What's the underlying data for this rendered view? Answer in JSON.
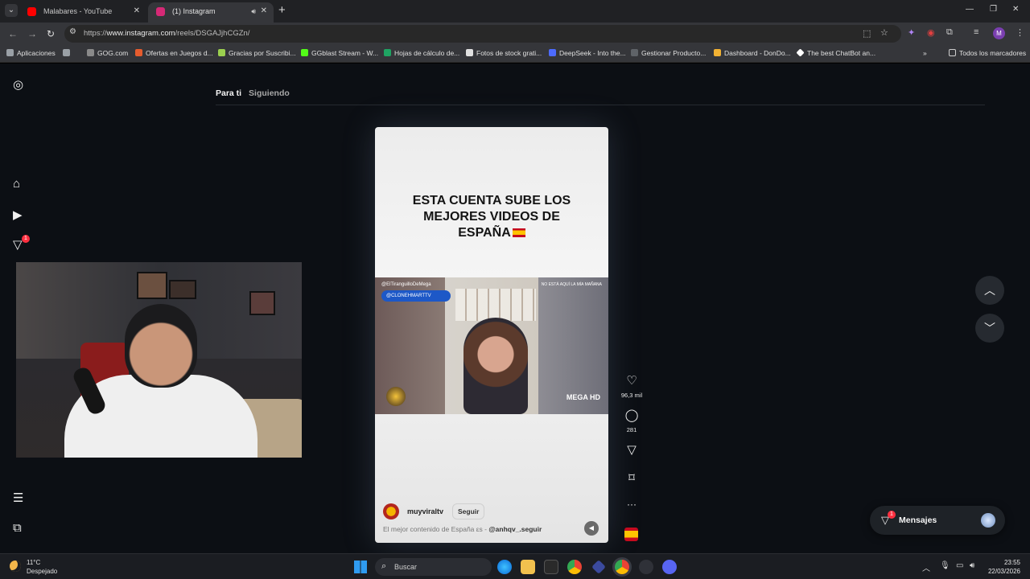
{
  "browser": {
    "tabs": [
      {
        "label": "Malabares - YouTube",
        "active": false,
        "favicon_color": "#ff0000"
      },
      {
        "label": "(1) Instagram",
        "active": true,
        "favicon_color": "#d62976"
      }
    ],
    "url_prefix": "https://",
    "url_host": "www.instagram.com",
    "url_path": "/reels/DSGAJjhCGZn/",
    "bookmarks": [
      {
        "label": "Aplicaciones",
        "icon": "apps-grid-icon"
      },
      {
        "label": "GOG.com",
        "icon": "gog-icon"
      },
      {
        "label": "Ofertas en Juegos d...",
        "icon": "tag-icon"
      },
      {
        "label": "Gracias por Suscribi...",
        "icon": "mail-icon"
      },
      {
        "label": "GGblast Stream - W...",
        "icon": "k-icon"
      },
      {
        "label": "Hojas de cálculo de...",
        "icon": "sheets-icon"
      },
      {
        "label": "Fotos de stock grati...",
        "icon": "photo-icon"
      },
      {
        "label": "DeepSeek - Into the...",
        "icon": "deepseek-icon"
      },
      {
        "label": "Gestionar Producto...",
        "icon": "box-icon"
      },
      {
        "label": "Dashboard - DonDo...",
        "icon": "folder-icon"
      },
      {
        "label": "The best ChatBot an...",
        "icon": "diamond-icon"
      }
    ],
    "bookmarks_overflow": "»",
    "all_bookmarks": "Todos los marcadores",
    "profile_initial": "M"
  },
  "instagram": {
    "feed_tabs": [
      "Para ti",
      "Siguiendo"
    ],
    "sidebar_badge": "1",
    "reel": {
      "headline_lines": [
        "ESTA CUENTA SUBE LOS",
        "MEJORES VIDEOS DE",
        "ESPAÑA"
      ],
      "overlay_handle": "@CLONEHMARTTV",
      "overlay_top_left": "@ElTiranguilloDeMega",
      "overlay_top_right": "NO ESTÁ AQUÍ LA MÍA MAÑANA",
      "overlay_brand": "MEGA HD",
      "author": "muyviraltv",
      "follow_label": "Seguir",
      "caption_text": "El mejor contenido de España εs - ",
      "caption_mention": "@anhqv_.seguir"
    },
    "actions": {
      "likes": "96,3 mil",
      "comments": "281",
      "more": "···"
    },
    "messages": {
      "label": "Mensajes",
      "badge": "1"
    }
  },
  "taskbar": {
    "weather_temp": "11°C",
    "weather_desc": "Despejado",
    "search_placeholder": "Buscar",
    "time": "23:55",
    "date": "22/03/2026"
  }
}
